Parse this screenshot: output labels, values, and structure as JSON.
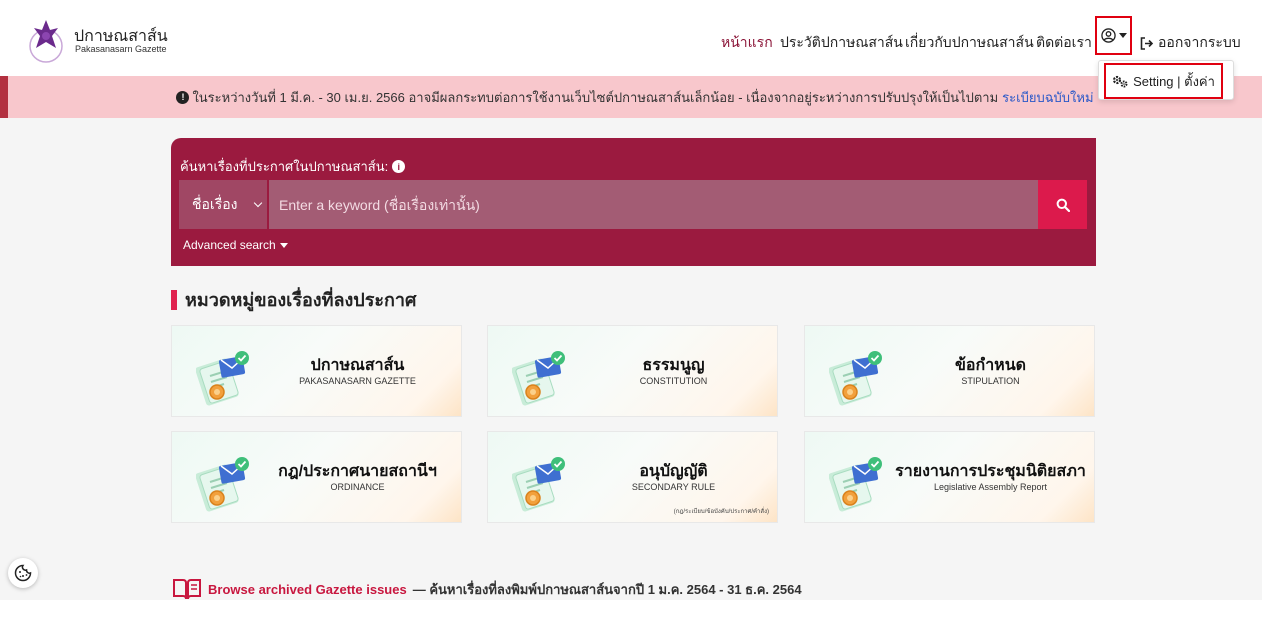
{
  "brand": {
    "name_th": "ปกาษณสาส์น",
    "name_en": "Pakasanasarn Gazette"
  },
  "nav": {
    "home": "หน้าแรก",
    "history": "ประวัติปกาษณสาส์น",
    "about": "เกี่ยวกับปกาษณสาส์น",
    "contact": "ติดต่อเรา",
    "logout": "ออกจากระบบ"
  },
  "dropdown": {
    "setting": "Setting | ตั้งค่า"
  },
  "banner": {
    "text": "ในระหว่างวันที่ 1 มี.ค. - 30 เม.ย. 2566 อาจมีผลกระทบต่อการใช้งานเว็บไซต์ปกาษณสาส์นเล็กน้อย - เนื่องจากอยู่ระหว่างการปรับปรุงให้เป็นไปตาม",
    "link": "ระเบียบฉบับใหม่"
  },
  "search": {
    "label": "ค้นหาเรื่องที่ประกาศในปกาษณสาส์น:",
    "select_value": "ชื่อเรื่อง",
    "placeholder": "Enter a keyword (ชื่อเรื่องเท่านั้น)",
    "advanced": "Advanced search"
  },
  "categories": {
    "title": "หมวดหมู่ของเรื่องที่ลงประกาศ",
    "cards": [
      {
        "th": "ปกาษณสาส์น",
        "en": "PAKASANASARN GAZETTE"
      },
      {
        "th": "ธรรมนูญ",
        "en": "CONSTITUTION"
      },
      {
        "th": "ข้อกำหนด",
        "en": "STIPULATION"
      },
      {
        "th": "กฎ/ประกาศนายสถานีฯ",
        "en": "ORDINANCE"
      },
      {
        "th": "อนุบัญญัติ",
        "en": "SECONDARY RULE",
        "note": "(กฎ/ระเบียบ/ข้อบังคับ/ประกาศ/คำสั่ง)"
      },
      {
        "th": "รายงานการประชุมนิติยสภา",
        "en": "Legislative Assembly Report"
      }
    ]
  },
  "archive": {
    "link": "Browse archived Gazette issues",
    "text": "— ค้นหาเรื่องที่ลงพิมพ์ปกาษณสาส์นจากปี 1 ม.ค. 2564 - 31 ธ.ค. 2564"
  },
  "colors": {
    "brand": "#9b1a3f",
    "accent": "#dc1a4c",
    "highlight": "#e00010",
    "banner_bg": "#f8c7cc"
  }
}
